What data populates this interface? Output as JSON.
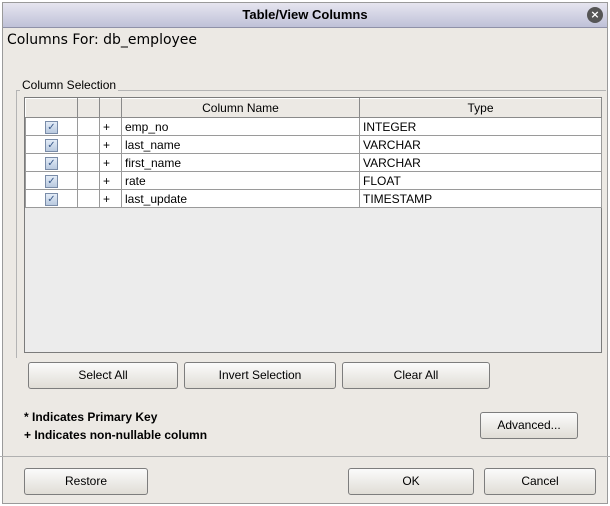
{
  "window": {
    "title": "Table/View Columns",
    "close_glyph": "×"
  },
  "columns_for": "Columns For: db_employee",
  "group_label": "Column Selection",
  "table": {
    "headers": [
      "",
      "",
      "",
      "Column Name",
      "Type"
    ],
    "rows": [
      {
        "checked": true,
        "pk": "",
        "nullable": "+",
        "name": "emp_no",
        "type": "INTEGER"
      },
      {
        "checked": true,
        "pk": "",
        "nullable": "+",
        "name": "last_name",
        "type": "VARCHAR"
      },
      {
        "checked": true,
        "pk": "",
        "nullable": "+",
        "name": "first_name",
        "type": "VARCHAR"
      },
      {
        "checked": true,
        "pk": "",
        "nullable": "+",
        "name": "rate",
        "type": "FLOAT"
      },
      {
        "checked": true,
        "pk": "",
        "nullable": "+",
        "name": "last_update",
        "type": "TIMESTAMP"
      }
    ]
  },
  "buttons": {
    "select_all": "Select All",
    "invert_selection": "Invert Selection",
    "clear_all": "Clear All",
    "advanced": "Advanced...",
    "restore": "Restore",
    "ok": "OK",
    "cancel": "Cancel"
  },
  "notes": {
    "primary_key": "* Indicates Primary Key",
    "non_nullable": "+ Indicates non-nullable column"
  }
}
